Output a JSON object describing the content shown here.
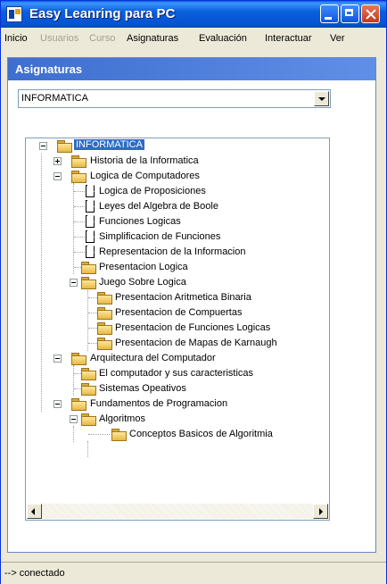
{
  "window": {
    "title": "Easy Leanring para PC"
  },
  "menubar": {
    "items": [
      {
        "label": "Inicio",
        "enabled": true
      },
      {
        "label": "Usuarios",
        "enabled": false
      },
      {
        "label": "Curso",
        "enabled": false
      },
      {
        "label": "Asignaturas",
        "enabled": true
      },
      {
        "label": "Evaluación",
        "enabled": true
      },
      {
        "label": "Interactuar",
        "enabled": true
      },
      {
        "label": "Ver",
        "enabled": true
      }
    ]
  },
  "panel": {
    "title": "Asignaturas",
    "combo_value": "INFORMATICA"
  },
  "tree": [
    {
      "label": "INFORMATICA",
      "type": "folder",
      "expander": "minus",
      "selected": true
    },
    {
      "label": "Historia de la Informatica",
      "type": "folder",
      "expander": "plus"
    },
    {
      "label": "Logica de Computadores",
      "type": "folder",
      "expander": "minus"
    },
    {
      "label": "Logica de Proposiciones",
      "type": "page"
    },
    {
      "label": "Leyes del Algebra de Boole",
      "type": "page"
    },
    {
      "label": "Funciones Logicas",
      "type": "page"
    },
    {
      "label": "Simplificacion de Funciones",
      "type": "page"
    },
    {
      "label": "Representacion de la Informacion",
      "type": "page"
    },
    {
      "label": "Presentacion Logica",
      "type": "folder"
    },
    {
      "label": "Juego Sobre Logica",
      "type": "folder",
      "expander": "minus"
    },
    {
      "label": "Presentacion Aritmetica Binaria",
      "type": "folder"
    },
    {
      "label": "Presentacion de Compuertas",
      "type": "folder"
    },
    {
      "label": "Presentacion de Funciones Logicas",
      "type": "folder"
    },
    {
      "label": "Presentacion de Mapas de Karnaugh",
      "type": "folder"
    },
    {
      "label": "Arquitectura del Computador",
      "type": "folder",
      "expander": "minus"
    },
    {
      "label": "El computador y sus caracteristicas",
      "type": "folder"
    },
    {
      "label": "Sistemas Opeativos",
      "type": "folder"
    },
    {
      "label": "Fundamentos de Programacion",
      "type": "folder",
      "expander": "minus"
    },
    {
      "label": "Algoritmos",
      "type": "folder",
      "expander": "minus"
    },
    {
      "label": "Conceptos Basicos de Algoritmia",
      "type": "folder"
    }
  ],
  "status": {
    "text": "--> conectado"
  },
  "colors": {
    "title_bar": "#0a5fdc",
    "panel_header": "#3e6ecf",
    "selection": "#316ac5"
  }
}
